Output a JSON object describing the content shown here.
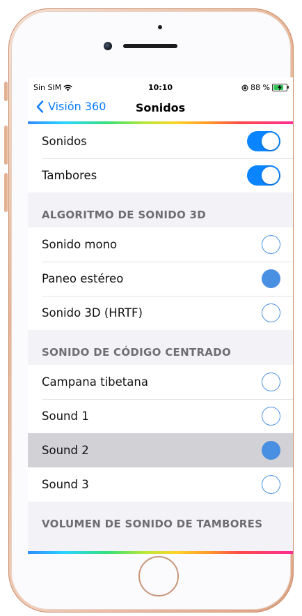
{
  "colors": {
    "accent": "#0a7aff",
    "toggle_on": "#0a84ff",
    "radio": "#4a90e2",
    "selected_row": "#d1d1d6",
    "header_text": "#6d6d72",
    "phone_frame": "#e7b595"
  },
  "status_bar": {
    "carrier": "Sin SIM",
    "wifi_icon": "wifi-icon",
    "time": "10:10",
    "orientation_lock_icon": "orientation-lock-icon",
    "battery_percent": "88 %",
    "battery_level": 0.88,
    "charging_icon": "charging-bolt-icon"
  },
  "nav": {
    "back_label": "Visión 360",
    "back_icon": "chevron-left-icon",
    "title": "Sonidos"
  },
  "sections": [
    {
      "header": "",
      "items": [
        {
          "label": "Sonidos",
          "control": "toggle",
          "on": true
        },
        {
          "label": "Tambores",
          "control": "toggle",
          "on": true
        }
      ]
    },
    {
      "header": "ALGORITMO DE SONIDO 3D",
      "items": [
        {
          "label": "Sonido mono",
          "control": "radio",
          "checked": false
        },
        {
          "label": "Paneo estéreo",
          "control": "radio",
          "checked": true
        },
        {
          "label": "Sonido 3D (HRTF)",
          "control": "radio",
          "checked": false
        }
      ]
    },
    {
      "header": "SONIDO DE CÓDIGO CENTRADO",
      "items": [
        {
          "label": "Campana tibetana",
          "control": "radio",
          "checked": false
        },
        {
          "label": "Sound 1",
          "control": "radio",
          "checked": false
        },
        {
          "label": "Sound 2",
          "control": "radio",
          "checked": true,
          "highlighted": true
        },
        {
          "label": "Sound 3",
          "control": "radio",
          "checked": false
        }
      ]
    },
    {
      "header": "VOLUMEN DE SONIDO DE TAMBORES",
      "items": []
    }
  ]
}
